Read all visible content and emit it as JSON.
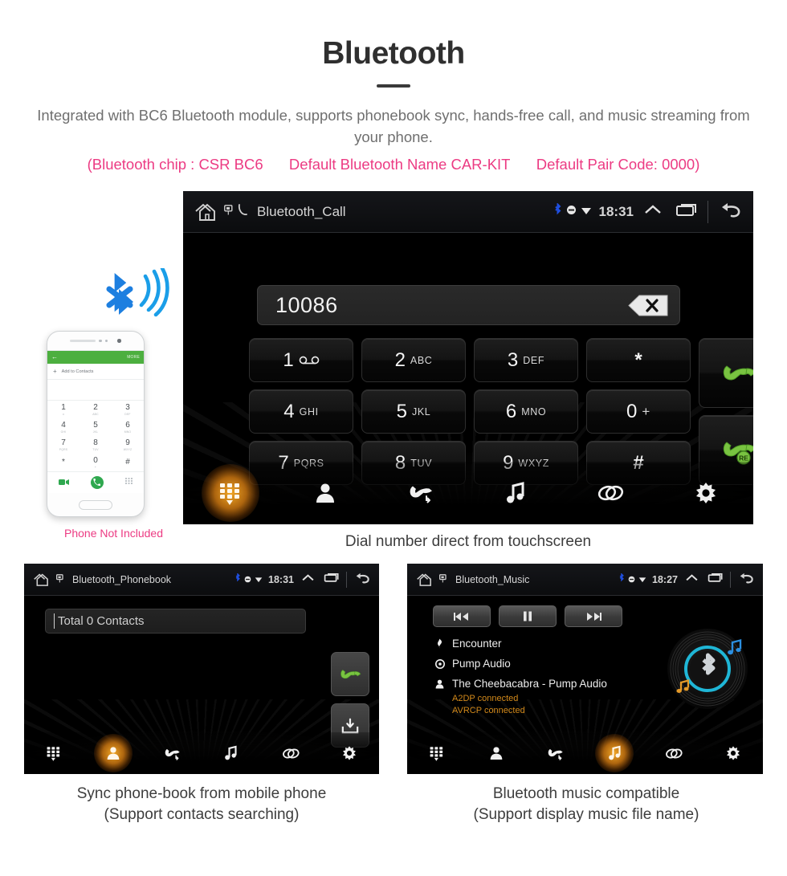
{
  "header": {
    "title": "Bluetooth",
    "description": "Integrated with BC6 Bluetooth module, supports phonebook sync, hands-free call, and music streaming from your phone.",
    "spec_chip": "(Bluetooth chip : CSR BC6",
    "spec_name": "Default Bluetooth Name CAR-KIT",
    "spec_pair": "Default Pair Code: 0000)",
    "accent_color": "#ec3b83",
    "text_color": "#6f6f6f"
  },
  "phone_illustration": {
    "note": "Phone Not Included",
    "bluetooth_icon": "bluetooth-signal-icon",
    "app_back": "←",
    "app_more": "MORE",
    "add_contacts": "Add to Contacts",
    "plus": "+",
    "keys": [
      {
        "digit": "1",
        "letters": "∞"
      },
      {
        "digit": "2",
        "letters": "ABC"
      },
      {
        "digit": "3",
        "letters": "DEF"
      },
      {
        "digit": "4",
        "letters": "GHI"
      },
      {
        "digit": "5",
        "letters": "JKL"
      },
      {
        "digit": "6",
        "letters": "MNO"
      },
      {
        "digit": "7",
        "letters": "PQRS"
      },
      {
        "digit": "8",
        "letters": "TUV"
      },
      {
        "digit": "9",
        "letters": "WXYZ"
      },
      {
        "digit": "*",
        "letters": ""
      },
      {
        "digit": "0",
        "letters": "+"
      },
      {
        "digit": "#",
        "letters": ""
      }
    ]
  },
  "call_screen": {
    "status": {
      "title": "Bluetooth_Call",
      "time": "18:31",
      "bluetooth_color": "#1f4fe0",
      "icons": [
        "bluetooth-icon",
        "mute-icon",
        "wifi-icon",
        "chevron-up-icon",
        "recents-icon",
        "back-icon"
      ]
    },
    "dial_number": "10086",
    "backspace_label": "backspace-icon",
    "keys": [
      {
        "digit": "1",
        "letters": "",
        "icon": "voicemail-icon"
      },
      {
        "digit": "2",
        "letters": "ABC",
        "icon": ""
      },
      {
        "digit": "3",
        "letters": "DEF",
        "icon": ""
      },
      {
        "digit": "*",
        "letters": "",
        "icon": ""
      },
      {
        "digit": "4",
        "letters": "GHI",
        "icon": ""
      },
      {
        "digit": "5",
        "letters": "JKL",
        "icon": ""
      },
      {
        "digit": "6",
        "letters": "MNO",
        "icon": ""
      },
      {
        "digit": "0",
        "letters": "+",
        "icon": ""
      },
      {
        "digit": "7",
        "letters": "PQRS",
        "icon": ""
      },
      {
        "digit": "8",
        "letters": "TUV",
        "icon": ""
      },
      {
        "digit": "9",
        "letters": "WXYZ",
        "icon": ""
      },
      {
        "digit": "#",
        "letters": "",
        "icon": ""
      }
    ],
    "call_button": "call-button",
    "redial_button": "redial-button",
    "redial_badge": "RE",
    "nav": [
      {
        "name": "keypad",
        "active": true
      },
      {
        "name": "contacts",
        "active": false
      },
      {
        "name": "call-history",
        "active": false
      },
      {
        "name": "music",
        "active": false
      },
      {
        "name": "pair-link",
        "active": false
      },
      {
        "name": "settings",
        "active": false
      }
    ],
    "caption": "Dial number direct from touchscreen"
  },
  "phonebook_screen": {
    "status": {
      "title": "Bluetooth_Phonebook",
      "time": "18:31"
    },
    "search_value": "Total 0 Contacts",
    "call_button": "call-button",
    "sync_button": "download-sync-button",
    "nav": [
      {
        "name": "keypad",
        "active": false
      },
      {
        "name": "contacts",
        "active": true
      },
      {
        "name": "call-history",
        "active": false
      },
      {
        "name": "music",
        "active": false
      },
      {
        "name": "pair-link",
        "active": false
      },
      {
        "name": "settings",
        "active": false
      }
    ],
    "caption_line1": "Sync phone-book from mobile phone",
    "caption_line2": "(Support contacts searching)"
  },
  "music_screen": {
    "status": {
      "title": "Bluetooth_Music",
      "time": "18:27"
    },
    "controls": [
      "previous-button",
      "pause-button",
      "next-button"
    ],
    "track_title": "Encounter",
    "album": "Pump Audio",
    "artist": "The Cheebacabra - Pump Audio",
    "status_a2dp": "A2DP connected",
    "status_avrcp": "AVRCP connected",
    "status_color": "#d2891a",
    "album_art": "vinyl-bluetooth-icon",
    "nav": [
      {
        "name": "keypad",
        "active": false
      },
      {
        "name": "contacts",
        "active": false
      },
      {
        "name": "call-history",
        "active": false
      },
      {
        "name": "music",
        "active": true
      },
      {
        "name": "pair-link",
        "active": false
      },
      {
        "name": "settings",
        "active": false
      }
    ],
    "caption_line1": "Bluetooth music compatible",
    "caption_line2": "(Support display music file name)"
  }
}
